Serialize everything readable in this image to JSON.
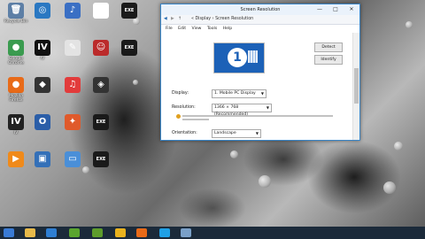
{
  "desktop_icons": [
    {
      "label": "Recycle Bin",
      "icon": "recycle-bin-icon",
      "color": "#5d7fa6",
      "glyph": "🗑"
    },
    {
      "label": "Google Chrome",
      "icon": "chrome-icon",
      "color": "#3a9b4f",
      "glyph": "●"
    },
    {
      "label": "Mozilla Firefox",
      "icon": "firefox-icon",
      "color": "#e86a18",
      "glyph": "●"
    },
    {
      "label": "IV",
      "icon": "app-iv-icon",
      "color": "#222222",
      "glyph": "IV"
    },
    {
      "label": "",
      "icon": "orange-app-icon",
      "color": "#f08a1a",
      "glyph": "▶"
    },
    {
      "label": "",
      "icon": "globe-icon",
      "color": "#2a78c2",
      "glyph": "◎"
    },
    {
      "label": "IV",
      "icon": "app-iv-icon",
      "color": "#111111",
      "glyph": "IV"
    },
    {
      "label": "",
      "icon": "media-icon",
      "color": "#333333",
      "glyph": "◆"
    },
    {
      "label": "",
      "icon": "circle-app-icon",
      "color": "#2b5ea8",
      "glyph": "O"
    },
    {
      "label": "",
      "icon": "folder-icon",
      "color": "#3470b8",
      "glyph": "▣"
    },
    {
      "label": "",
      "icon": "installer-icon",
      "color": "#3a6fc4",
      "glyph": "♪"
    },
    {
      "label": "",
      "icon": "image-icon",
      "color": "#e3e3e3",
      "glyph": "✎"
    },
    {
      "label": "",
      "icon": "itunes-icon",
      "color": "#e23b3b",
      "glyph": "♫"
    },
    {
      "label": "",
      "icon": "software-icon",
      "color": "#e05a2b",
      "glyph": "✦"
    },
    {
      "label": "",
      "icon": "monitor-icon",
      "color": "#4a8fd8",
      "glyph": "▭"
    },
    {
      "label": "",
      "icon": "document-icon",
      "color": "#ffffff",
      "glyph": "≡"
    },
    {
      "label": "",
      "icon": "portrait-icon",
      "color": "#bb2b2b",
      "glyph": "☺"
    },
    {
      "label": "",
      "icon": "game-icon",
      "color": "#333333",
      "glyph": "◈"
    },
    {
      "label": "",
      "icon": "exe-icon",
      "color": "#1a1a1a",
      "glyph": "EXE"
    },
    {
      "label": "",
      "icon": "exe-icon",
      "color": "#1a1a1a",
      "glyph": "EXE"
    },
    {
      "label": "",
      "icon": "exe-icon",
      "color": "#1a1a1a",
      "glyph": "EXE"
    },
    {
      "label": "",
      "icon": "exe-icon",
      "color": "#1a1a1a",
      "glyph": "EXE"
    }
  ],
  "window": {
    "title": "Screen Resolution",
    "address": "« Display › Screen Resolution",
    "menu": [
      "File",
      "Edit",
      "View",
      "Tools",
      "Help"
    ],
    "detect_label": "Detect",
    "identify_label": "Identify",
    "monitor_number": "1",
    "display_label": "Display:",
    "display_value": "1. Mobile PC Display",
    "resolution_label": "Resolution:",
    "resolution_value": "1366 × 768 (Recommended)",
    "orientation_label": "Orientation:",
    "orientation_value": "Landscape"
  },
  "taskbar": {
    "items": [
      {
        "icon": "windows-icon",
        "color": "#3a7bd5"
      },
      {
        "icon": "folder-icon",
        "color": "#e6b94a"
      },
      {
        "icon": "ie-icon",
        "color": "#2f7fd3"
      },
      {
        "icon": "store-icon",
        "color": "#5aa52f"
      },
      {
        "icon": "torrent-icon",
        "color": "#5d9c2c"
      },
      {
        "icon": "chrome-icon",
        "color": "#e9b21e"
      },
      {
        "icon": "firefox-icon",
        "color": "#e86a18"
      },
      {
        "icon": "skype-icon",
        "color": "#1fa0e6"
      },
      {
        "icon": "monitor-icon",
        "color": "#7aa0c8"
      }
    ]
  }
}
